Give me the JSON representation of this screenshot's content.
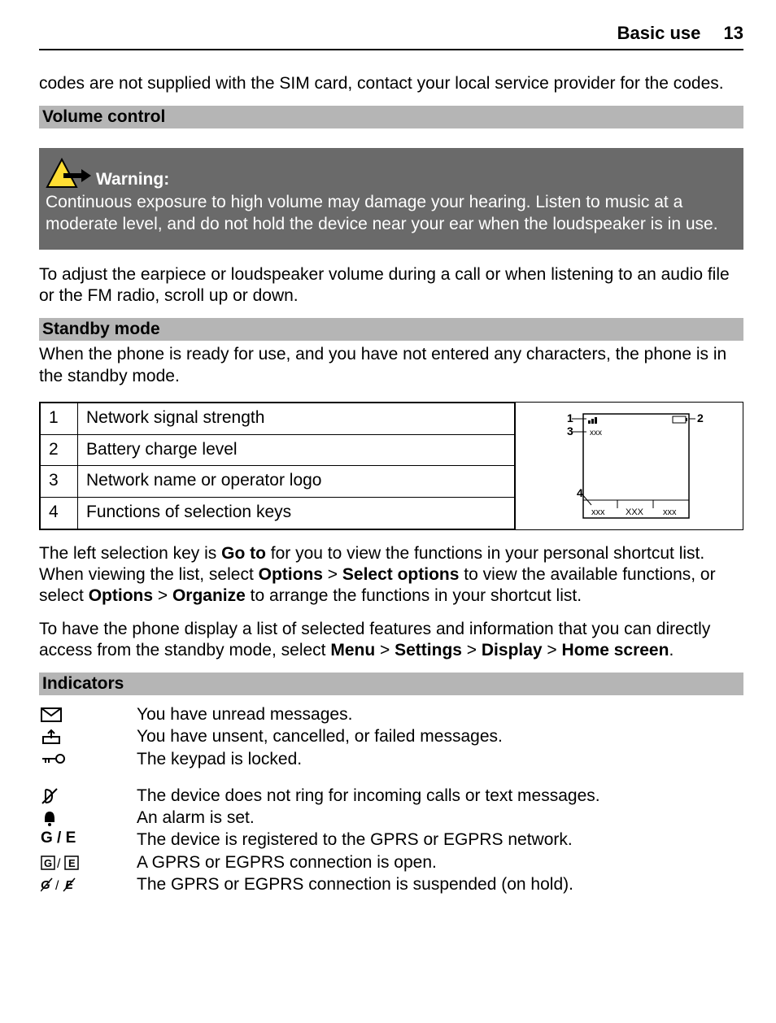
{
  "header": {
    "section": "Basic use",
    "page": "13"
  },
  "intro_continued": "codes are not supplied with the SIM card, contact your local service provider for the codes.",
  "sections": {
    "volume_control": "Volume control",
    "standby_mode": "Standby mode",
    "indicators": "Indicators"
  },
  "warning": {
    "label": "Warning:",
    "text": "Continuous exposure to high volume may damage your hearing. Listen to music at a moderate level, and do not hold the device near your ear when the loudspeaker is in use."
  },
  "volume_body": "To adjust the earpiece or loudspeaker volume during a call or when listening to an audio file or the FM radio, scroll up or down.",
  "standby_intro": "When the phone is ready for use, and you have not entered any characters, the phone is in the standby mode.",
  "standby_table": [
    {
      "n": "1",
      "label": "Network signal strength"
    },
    {
      "n": "2",
      "label": "Battery charge level"
    },
    {
      "n": "3",
      "label": "Network name or operator logo"
    },
    {
      "n": "4",
      "label": "Functions of selection keys"
    }
  ],
  "standby_para1": {
    "pre": "The left selection key is ",
    "b1": "Go to",
    "mid1": " for you to view the functions in your personal shortcut list. When viewing the list, select ",
    "b2": "Options",
    "gt1": " > ",
    "b3": "Select options",
    "mid2": " to view the available functions, or select ",
    "b4": "Options",
    "gt2": " > ",
    "b5": "Organize",
    "post": " to arrange the functions in your shortcut list."
  },
  "standby_para2": {
    "pre": "To have the phone display a list of selected features and information that you can directly access from the standby mode, select ",
    "b1": "Menu",
    "gt1": " > ",
    "b2": "Settings",
    "gt2": " > ",
    "b3": "Display",
    "gt3": " > ",
    "b4": "Home screen",
    "post": "."
  },
  "indicators": {
    "group1": [
      {
        "icon": "mail",
        "text": "You have unread messages."
      },
      {
        "icon": "outbox",
        "text": "You have unsent, cancelled, or failed messages."
      },
      {
        "icon": "keylock",
        "text": "The keypad is locked."
      }
    ],
    "group2": [
      {
        "icon": "silent",
        "text": "The device does not ring for incoming calls or text messages."
      },
      {
        "icon": "alarm",
        "text": "An alarm is set."
      },
      {
        "icon": "ge",
        "text": "The device is registered to the GPRS or EGPRS network."
      },
      {
        "icon": "ge-box",
        "text": "A GPRS or EGPRS connection is open."
      },
      {
        "icon": "ge-dash",
        "text": "The GPRS or EGPRS connection is suspended (on hold)."
      }
    ]
  },
  "glyphs": {
    "ge": "G / E",
    "ge_box": "🄶 / 🄴",
    "fig": {
      "l1": "1",
      "l2": "2",
      "l3": "3",
      "l4": "4",
      "x": "xxx",
      "xU": "XXX"
    }
  }
}
